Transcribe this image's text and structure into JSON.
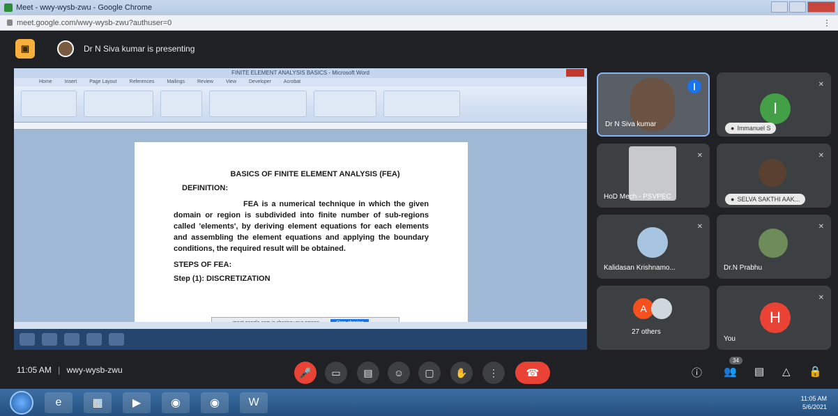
{
  "browser": {
    "window_title": "Meet - wwy-wysb-zwu - Google Chrome",
    "url": "meet.google.com/wwy-wysb-zwu?authuser=0"
  },
  "banner": {
    "presenting_text": "Dr N Siva kumar is presenting"
  },
  "shared_screen": {
    "word_title": "FINITE ELEMENT ANALYSIS BASICS - Microsoft Word",
    "ribbon_tabs": [
      "Home",
      "Insert",
      "Page Layout",
      "References",
      "Mailings",
      "Review",
      "View",
      "Developer",
      "Acrobat"
    ],
    "document": {
      "heading": "BASICS OF FINITE ELEMENT ANALYSIS (FEA)",
      "definition_label": "DEFINITION:",
      "paragraph": "FEA  is a numerical technique in which the given domain or region is subdivided into finite number of sub-regions called 'elements', by deriving element equations for each elements and assembling the element equations and applying the boundary conditions, the required result will be obtained.",
      "steps_label": "STEPS OF FEA:",
      "step1": "Step (1): DISCRETIZATION"
    },
    "share_notice": "meet.google.com is sharing your screen.",
    "stop_sharing": "Stop sharing"
  },
  "participants": [
    {
      "name": "Dr N Siva kumar",
      "speaking": true
    },
    {
      "name": "Immanuel S",
      "initial": "I",
      "color": "#43a047"
    },
    {
      "name": "HoD Mech - PSVPEC"
    },
    {
      "name": "SELVA SAKTHI AAK..."
    },
    {
      "name": "Kalidasan Krishnamo..."
    },
    {
      "name": "Dr.N Prabhu"
    },
    {
      "name": "27 others",
      "initial": "A"
    },
    {
      "name": "You",
      "initial": "H",
      "color": "#ea4335"
    }
  ],
  "controls": {
    "time": "11:05 AM",
    "meeting_code": "wwy-wysb-zwu",
    "people_count": "34"
  },
  "taskbar": {
    "clock_time": "11:05 AM",
    "clock_date": "5/6/2021"
  }
}
